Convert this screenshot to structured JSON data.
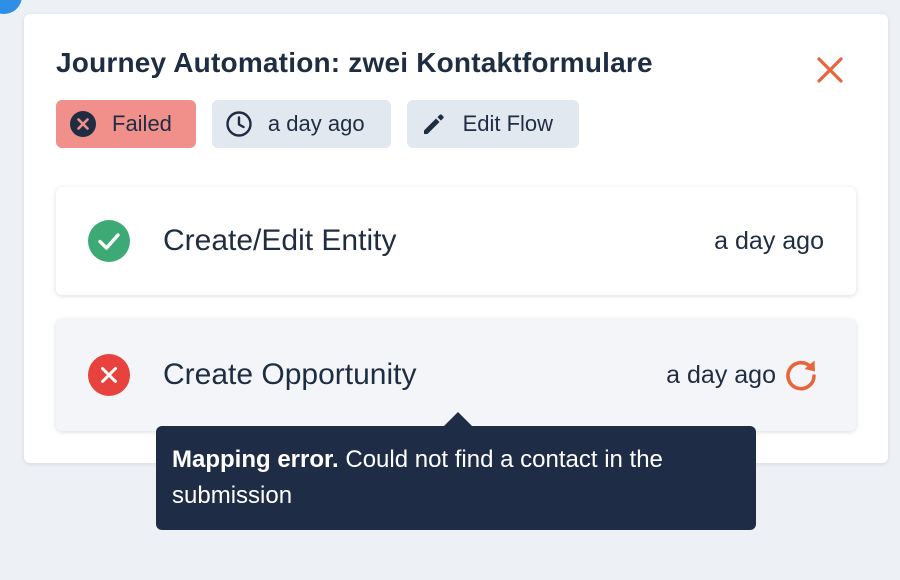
{
  "panel": {
    "title": "Journey Automation: zwei Kontaktformulare",
    "close_icon": "close-icon",
    "accent_color": "#e8643c"
  },
  "chips": {
    "status": {
      "label": "Failed",
      "icon": "x-circle-icon",
      "color": "#f1908a"
    },
    "time": {
      "label": "a day ago",
      "icon": "clock-icon"
    },
    "edit": {
      "label": "Edit Flow",
      "icon": "pencil-icon"
    }
  },
  "steps": [
    {
      "name": "Create/Edit Entity",
      "time": "a day ago",
      "status": "success",
      "status_color": "#3daa76"
    },
    {
      "name": "Create Opportunity",
      "time": "a day ago",
      "status": "error",
      "status_color": "#e8423f",
      "retry_icon": "retry-icon"
    }
  ],
  "tooltip": {
    "title": "Mapping error.",
    "message": "Could not find a contact in the submission"
  }
}
